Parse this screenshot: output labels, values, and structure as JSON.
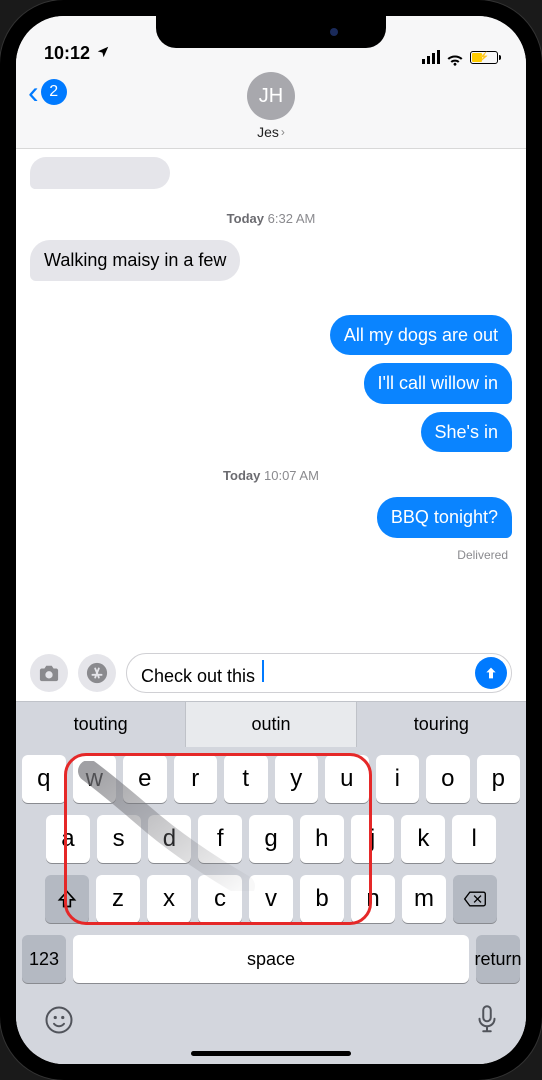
{
  "status": {
    "time": "10:12",
    "location_icon": "◤"
  },
  "header": {
    "back_badge": "2",
    "avatar_initials": "JH",
    "contact_name": "Jes"
  },
  "thread": {
    "ts1_day": "Today",
    "ts1_time": "6:32 AM",
    "msg_in_1": "Walking maisy in a few",
    "msg_out_1": "All my dogs are out",
    "msg_out_2": "I'll call willow in",
    "msg_out_3": "She's in",
    "ts2_day": "Today",
    "ts2_time": "10:07 AM",
    "msg_out_4": "BBQ tonight?",
    "delivered": "Delivered"
  },
  "input": {
    "value": "Check out this "
  },
  "suggestions": {
    "s1": "touting",
    "s2": "outin",
    "s3": "touring"
  },
  "keys": {
    "r1": [
      "q",
      "w",
      "e",
      "r",
      "t",
      "y",
      "u",
      "i",
      "o",
      "p"
    ],
    "r2": [
      "a",
      "s",
      "d",
      "f",
      "g",
      "h",
      "j",
      "k",
      "l"
    ],
    "r3": [
      "z",
      "x",
      "c",
      "v",
      "b",
      "n",
      "m"
    ],
    "num": "123",
    "space": "space",
    "ret": "return"
  }
}
